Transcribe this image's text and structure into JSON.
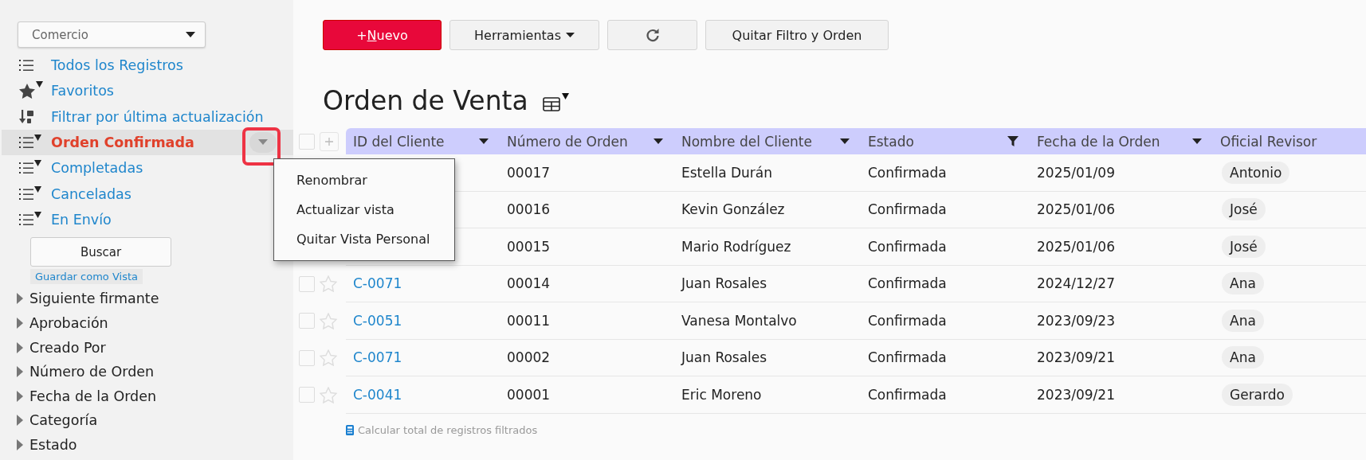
{
  "sidebar": {
    "app_select": {
      "value": "Comercio"
    },
    "views": [
      {
        "label": "Todos los Registros",
        "kind": "list",
        "filtered": false,
        "selected": false
      },
      {
        "label": "Favoritos",
        "kind": "star",
        "filtered": true,
        "selected": false
      },
      {
        "label": "Filtrar por última actualización",
        "kind": "sort",
        "filtered": false,
        "selected": false
      },
      {
        "label": "Orden Confirmada",
        "kind": "list",
        "filtered": true,
        "selected": true
      },
      {
        "label": "Completadas",
        "kind": "list",
        "filtered": true,
        "selected": false
      },
      {
        "label": "Canceladas",
        "kind": "list",
        "filtered": true,
        "selected": false
      },
      {
        "label": "En Envío",
        "kind": "list",
        "filtered": true,
        "selected": false
      }
    ],
    "search_button": "Buscar",
    "save_view_link": "Guardar como Vista",
    "fields": [
      {
        "label": "Siguiente firmante",
        "expanded": false
      },
      {
        "label": "Aprobación",
        "expanded": false
      },
      {
        "label": "Creado Por",
        "expanded": false
      },
      {
        "label": "Número de Orden",
        "expanded": false
      },
      {
        "label": "Fecha de la Orden",
        "expanded": false
      },
      {
        "label": "Categoría",
        "expanded": false
      },
      {
        "label": "Estado",
        "expanded": false
      }
    ]
  },
  "view_menu": {
    "items": [
      "Renombrar",
      "Actualizar vista",
      "Quitar Vista Personal"
    ]
  },
  "toolbar": {
    "new_button": {
      "prefix": "+",
      "key": "N",
      "rest": "uevo"
    },
    "tools_button": "Herramientas",
    "clear_button": "Quitar Filtro y Orden"
  },
  "title": "Orden de Venta",
  "table": {
    "columns": [
      {
        "label": "ID del Cliente",
        "kind": "sortable"
      },
      {
        "label": "Número de Orden",
        "kind": "sortable"
      },
      {
        "label": "Nombre del Cliente",
        "kind": "sortable"
      },
      {
        "label": "Estado",
        "kind": "filtered"
      },
      {
        "label": "Fecha de la Orden",
        "kind": "sortable"
      },
      {
        "label": "Oficial Revisor",
        "kind": "plain"
      }
    ],
    "select_all_checked": false,
    "rows": [
      {
        "order": "00017",
        "name": "Estella Durán",
        "status": "Confirmada",
        "date": "2025/01/09",
        "reviewer": "Antonio"
      },
      {
        "order": "00016",
        "name": "Kevin González",
        "status": "Confirmada",
        "date": "2025/01/06",
        "reviewer": "José"
      },
      {
        "order": "00015",
        "name": "Mario Rodríguez",
        "status": "Confirmada",
        "date": "2025/01/06",
        "reviewer": "José"
      },
      {
        "checked": false,
        "starred": false,
        "id": "C-0071",
        "order": "00014",
        "name": "Juan Rosales",
        "status": "Confirmada",
        "date": "2024/12/27",
        "reviewer": "Ana"
      },
      {
        "checked": false,
        "starred": false,
        "id": "C-0051",
        "order": "00011",
        "name": "Vanesa Montalvo",
        "status": "Confirmada",
        "date": "2023/09/23",
        "reviewer": "Ana"
      },
      {
        "checked": false,
        "starred": false,
        "id": "C-0071",
        "order": "00002",
        "name": "Juan Rosales",
        "status": "Confirmada",
        "date": "2023/09/21",
        "reviewer": "Ana"
      },
      {
        "checked": false,
        "starred": false,
        "id": "C-0041",
        "order": "00001",
        "name": "Eric Moreno",
        "status": "Confirmada",
        "date": "2023/09/21",
        "reviewer": "Gerardo"
      }
    ],
    "footer_link": "Calcular total de registros filtrados"
  }
}
